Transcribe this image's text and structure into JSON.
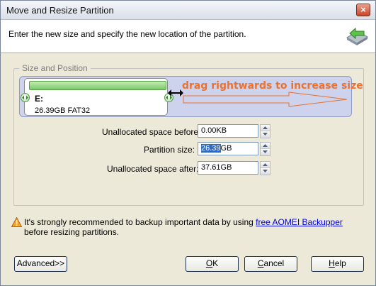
{
  "window": {
    "title": "Move and Resize Partition",
    "close_label": "×"
  },
  "header": {
    "instruction": "Enter the new size and specify the new location of the partition."
  },
  "group": {
    "label": "Size and Position"
  },
  "partition": {
    "letter": "E:",
    "info": "26.39GB FAT32"
  },
  "hint": {
    "text": "drag rightwards to increase size"
  },
  "fields": {
    "unallocated_before": {
      "label": "Unallocated space before:",
      "value": "0.00KB"
    },
    "partition_size": {
      "label": "Partition size:",
      "value_selected": "26.39",
      "value_unit": "GB"
    },
    "unallocated_after": {
      "label": "Unallocated space after:",
      "value": "37.61GB"
    }
  },
  "warning": {
    "text_before": "It's strongly recommended to backup important data by using ",
    "link": "free AOMEI Backupper",
    "text_after": " before resizing partitions."
  },
  "buttons": {
    "advanced": "Advanced>>",
    "ok_hotkey": "O",
    "ok_rest": "K",
    "cancel_hotkey": "C",
    "cancel_rest": "ancel",
    "help_hotkey": "H",
    "help_rest": "elp"
  },
  "colors": {
    "accent_orange": "#ea7131",
    "partition_green": "#7cc76a",
    "selection_blue": "#316ac5"
  }
}
